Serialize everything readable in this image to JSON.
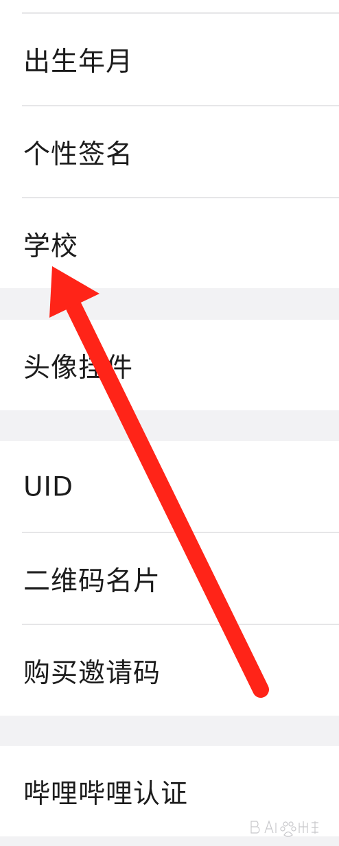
{
  "groups": [
    {
      "rows": [
        "出生年月",
        "个性签名",
        "学校"
      ]
    },
    {
      "rows": [
        "头像挂件"
      ]
    },
    {
      "rows": [
        "UID",
        "二维码名片",
        "购买邀请码"
      ]
    },
    {
      "rows": [
        "哔哩哔哩认证"
      ]
    }
  ],
  "colors": {
    "separator_bg": "#f2f2f4",
    "row_bg": "#ffffff",
    "divider": "#e6e6e8",
    "annotation_arrow": "#ff2418"
  },
  "watermark": {
    "brand": "Bai du 经验",
    "icon": "baidu-paw-icon"
  }
}
